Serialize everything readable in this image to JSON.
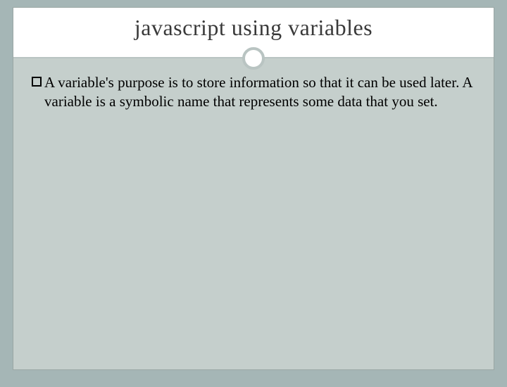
{
  "slide": {
    "title": "javascript using variables",
    "bullets": [
      "A variable's purpose is to store information so that it can be used later. A variable is a symbolic name that represents some data that you set."
    ]
  }
}
